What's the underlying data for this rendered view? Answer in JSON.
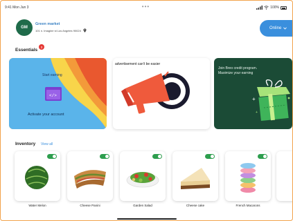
{
  "status_bar": {
    "time": "9:41 Mon Jun 3",
    "battery": "100%"
  },
  "header": {
    "avatar_initials": "GM",
    "store_name": "Green market",
    "store_address": "101 n. Imagine st Los Angeles 90024",
    "online_label": "Online"
  },
  "essentials": {
    "title": "Essentials",
    "badge_count": "3",
    "cards": [
      {
        "top_text": "Start earning",
        "bottom_text": "Activate your account"
      },
      {
        "text": "advertisement can't be easier"
      },
      {
        "text": "Join Breo credit program. Maximize your earning"
      }
    ]
  },
  "inventory": {
    "title": "Inventory",
    "view_all": "View all",
    "items": [
      {
        "name": "Water Melon",
        "enabled": true
      },
      {
        "name": "Cheese Panini",
        "enabled": true
      },
      {
        "name": "Garden Salad",
        "enabled": true
      },
      {
        "name": "Cheese cake",
        "enabled": true
      },
      {
        "name": "French Macarons",
        "enabled": true
      }
    ]
  },
  "colors": {
    "accent": "#3a8fdd",
    "brand_green": "#1f6b4a",
    "toggle_on": "#2e9e4e",
    "badge": "#e53935"
  }
}
